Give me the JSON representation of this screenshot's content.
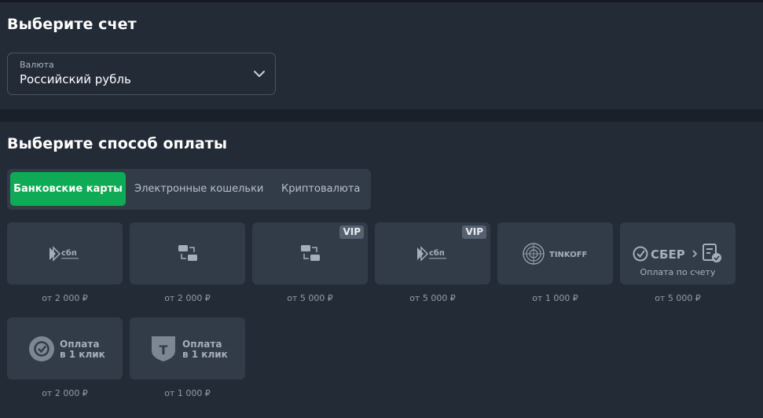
{
  "account": {
    "title": "Выберите счет",
    "currency_label": "Валюта",
    "currency_value": "Российский рубль"
  },
  "payment": {
    "title": "Выберите способ оплаты",
    "tabs": [
      {
        "label": "Банковские карты",
        "active": true
      },
      {
        "label": "Электронные кошельки",
        "active": false
      },
      {
        "label": "Криптовалюта",
        "active": false
      }
    ],
    "methods": [
      {
        "logo": "sbp-logo",
        "logo_text": "сбп",
        "vip": "",
        "price": "от 2 000 ₽"
      },
      {
        "logo": "bank-transfer-icon",
        "vip": "",
        "price": "от 2 000 ₽"
      },
      {
        "logo": "bank-transfer-icon",
        "vip": "VIP",
        "price": "от 5 000 ₽"
      },
      {
        "logo": "sbp-logo",
        "logo_text": "сбп",
        "vip": "VIP",
        "price": "от 5 000 ₽"
      },
      {
        "logo": "tinkoff-logo",
        "logo_text": "TINKOFF",
        "vip": "",
        "price": "от 1 000 ₽"
      },
      {
        "logo": "sber-logo",
        "logo_text": "СБЕР",
        "subtitle": "Оплата по счету",
        "vip": "",
        "price": "от 5 000 ₽"
      },
      {
        "logo": "sber-checkmark-icon",
        "line1": "Оплата",
        "line2": "в 1 клик",
        "vip": "",
        "price": "от 2 000 ₽"
      },
      {
        "logo": "tinkoff-shield-icon",
        "shield_letter": "T",
        "line1": "Оплата",
        "line2": "в 1 клик",
        "vip": "",
        "price": "от 1 000 ₽"
      }
    ]
  },
  "colors": {
    "background": "#1a2029",
    "panel": "#232b37",
    "card": "#323b48",
    "accent": "#0faa55",
    "muted_text": "#939ca8"
  }
}
